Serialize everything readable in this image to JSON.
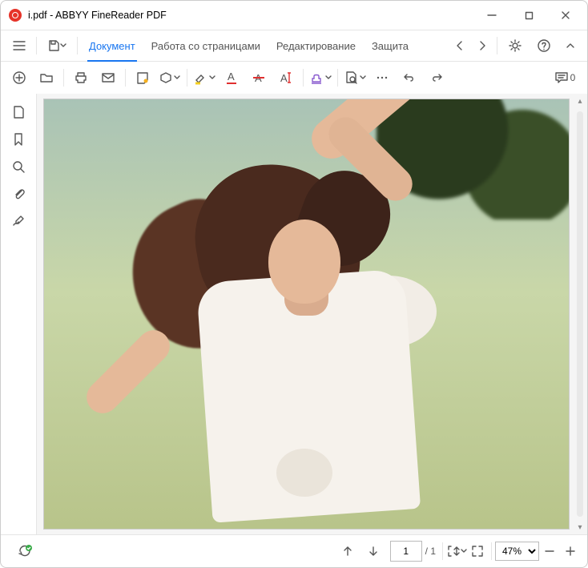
{
  "title": "i.pdf - ABBYY FineReader PDF",
  "menu": {
    "document": "Документ",
    "pages": "Работа со страницами",
    "edit": "Редактирование",
    "protect": "Защита"
  },
  "comments_count": "0",
  "status": {
    "current_page": "1",
    "page_sep": "/ 1",
    "zoom": "47%"
  }
}
